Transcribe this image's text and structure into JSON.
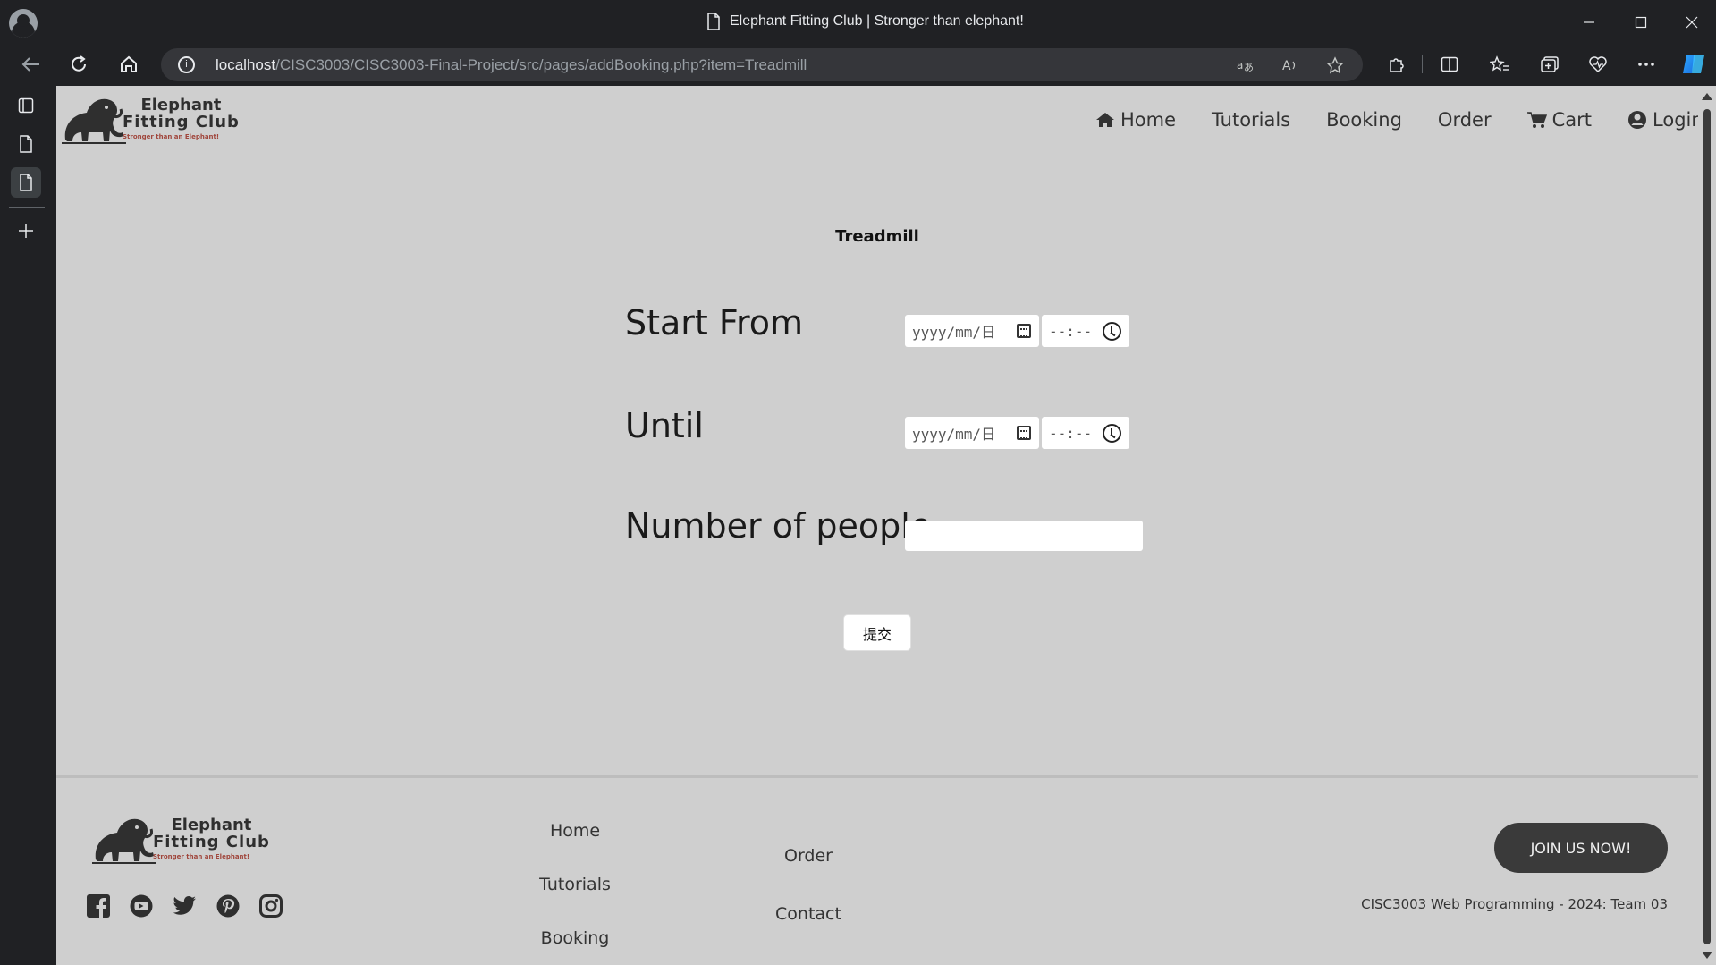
{
  "browser": {
    "tab_title": "Elephant Fitting Club | Stronger than elephant!",
    "url_host": "localhost",
    "url_path": "/CISC3003/CISC3003-Final-Project/src/pages/addBooking.php?item=Treadmill"
  },
  "site": {
    "logo_line1": "Elephant",
    "logo_line2": "Fitting Club",
    "logo_tagline": "Stronger than an Elephant!"
  },
  "nav": {
    "home": "Home",
    "tutorials": "Tutorials",
    "booking": "Booking",
    "order": "Order",
    "cart": "Cart",
    "login": "Login"
  },
  "form": {
    "title": "Treadmill",
    "start_label": "Start From",
    "until_label": "Until",
    "people_label": "Number of people",
    "date_placeholder": "yyyy/mm/日",
    "time_placeholder": "--:--",
    "people_value": "",
    "submit_label": "提交"
  },
  "footer": {
    "links_col1": [
      "Home",
      "Tutorials",
      "Booking"
    ],
    "links_col2": [
      "Order",
      "Contact"
    ],
    "join_label": "JOIN US NOW!",
    "copyright": "CISC3003 Web Programming - 2024: Team 03",
    "social_icons": [
      "facebook-icon",
      "youtube-icon",
      "twitter-icon",
      "pinterest-icon",
      "instagram-icon"
    ]
  },
  "colors": {
    "page_bg": "#cfcfcf",
    "chrome_bg": "#202124",
    "text_dark": "#333333",
    "join_button": "#3a3a3a",
    "logo_tagline": "#a0463c"
  }
}
